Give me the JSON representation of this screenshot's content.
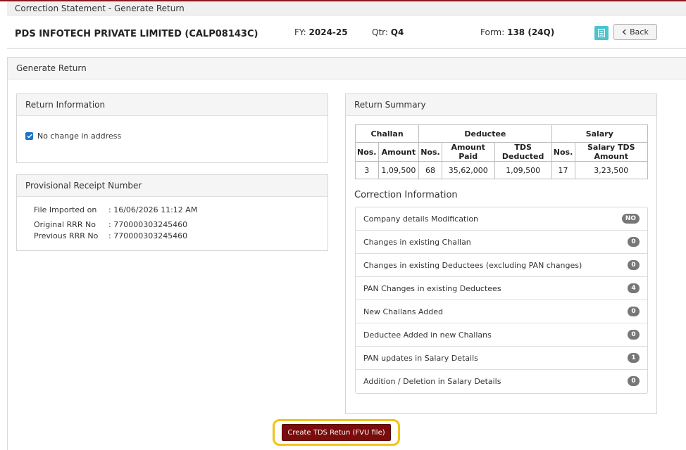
{
  "window": {
    "title": "Correction Statement - Generate Return"
  },
  "header": {
    "company": "PDS INFOTECH PRIVATE LIMITED (CALP08143C)",
    "fy_label": "FY:",
    "fy_value": "2024-25",
    "qtr_label": "Qtr:",
    "qtr_value": "Q4",
    "form_label": "Form:",
    "form_value": "138 (24Q)",
    "doc_icon": "document-icon",
    "back_label": "Back"
  },
  "main": {
    "title": "Generate Return"
  },
  "return_info": {
    "title": "Return Information",
    "checkbox_label": "No change in address",
    "checkbox_checked": true
  },
  "provisional": {
    "title": "Provisional Receipt Number",
    "rows": [
      {
        "key": "File Imported on",
        "value": ": 16/06/2026 11:12 AM"
      },
      {
        "key": "Original RRR No",
        "value": ": 770000303245460"
      },
      {
        "key": "Previous RRR No",
        "value": ": 770000303245460"
      }
    ]
  },
  "summary": {
    "title": "Return Summary",
    "groups": [
      "Challan",
      "Deductee",
      "Salary"
    ],
    "columns": [
      "Nos.",
      "Amount",
      "Nos.",
      "Amount Paid",
      "TDS Deducted",
      "Nos.",
      "Salary TDS Amount"
    ],
    "values": [
      "3",
      "1,09,500",
      "68",
      "35,62,000",
      "1,09,500",
      "17",
      "3,23,500"
    ]
  },
  "correction": {
    "title": "Correction Information",
    "items": [
      {
        "label": "Company details Modification",
        "badge": "NO"
      },
      {
        "label": "Changes in existing Challan",
        "badge": "0"
      },
      {
        "label": "Changes in existing Deductees (excluding PAN changes)",
        "badge": "0"
      },
      {
        "label": "PAN Changes in existing Deductees",
        "badge": "4"
      },
      {
        "label": "New Challans Added",
        "badge": "0"
      },
      {
        "label": "Deductee Added in new Challans",
        "badge": "0"
      },
      {
        "label": "PAN updates in Salary Details",
        "badge": "1"
      },
      {
        "label": "Addition / Deletion in Salary Details",
        "badge": "0"
      }
    ]
  },
  "actions": {
    "create_label": "Create TDS Retun (FVU file)"
  },
  "colors": {
    "accent_teal": "#4cc4cc",
    "primary_maroon": "#7a0c0c",
    "highlight_yellow": "#f2c21b",
    "badge_gray": "#777777"
  }
}
